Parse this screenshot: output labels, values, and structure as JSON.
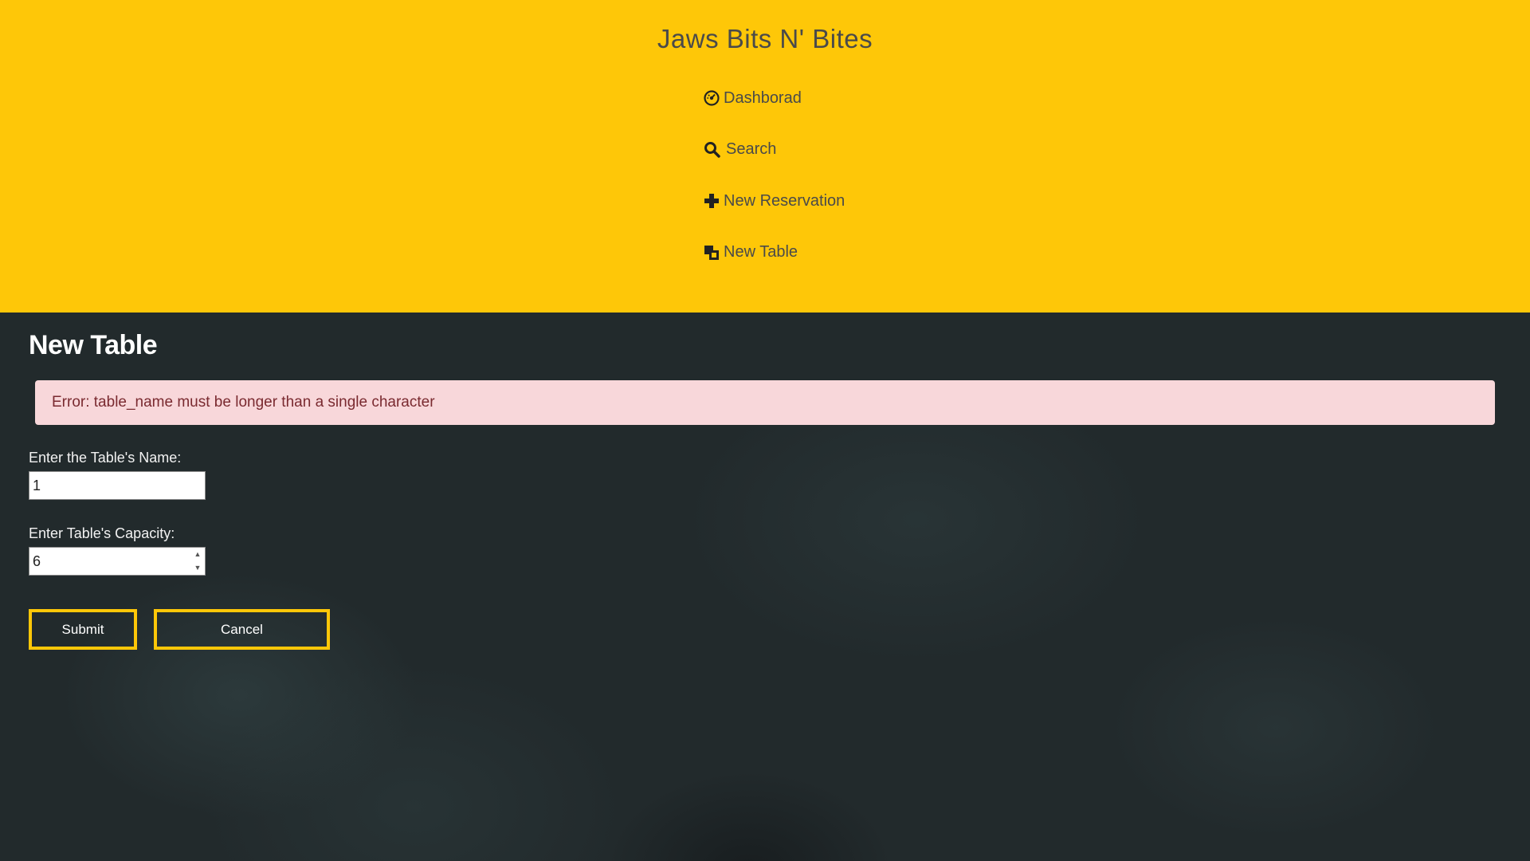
{
  "header": {
    "brand": "Jaws Bits N' Bites",
    "nav": [
      {
        "label": "Dashborad",
        "icon": "dashboard-gauge-icon"
      },
      {
        "label": "Search",
        "icon": "search-icon"
      },
      {
        "label": "New Reservation",
        "icon": "plus-icon"
      },
      {
        "label": "New Table",
        "icon": "clone-icon"
      }
    ]
  },
  "page": {
    "title": "New Table",
    "error": "Error: table_name must be longer than a single character"
  },
  "form": {
    "name_label": "Enter the Table's Name:",
    "name_value": "1",
    "capacity_label": "Enter Table's Capacity:",
    "capacity_value": "6",
    "submit_label": "Submit",
    "cancel_label": "Cancel"
  },
  "colors": {
    "header_bg": "#fec708",
    "main_bg": "#222a2c",
    "alert_bg": "#f8d7da",
    "alert_text": "#7a2a30",
    "button_border": "#fec708"
  }
}
